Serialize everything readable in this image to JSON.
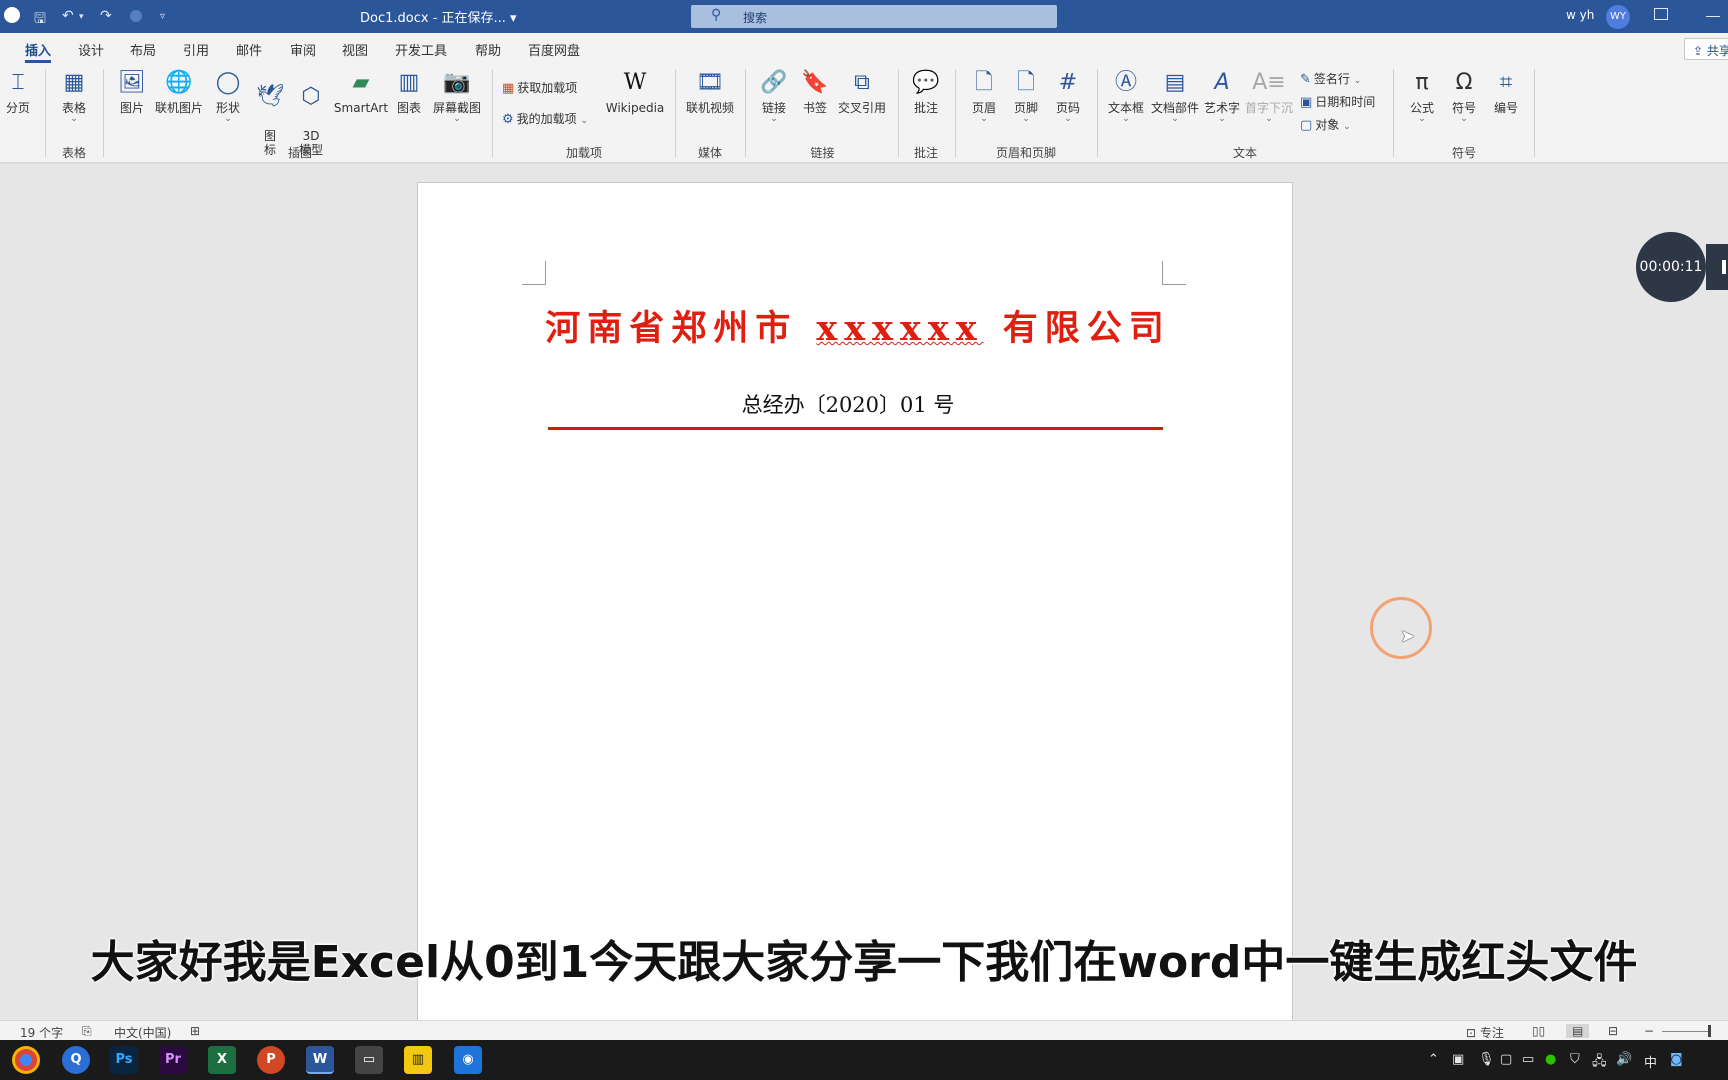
{
  "titlebar": {
    "doc_title": "Doc1.docx - 正在保存... ▾",
    "search_placeholder": "搜索",
    "user_name": "w yh",
    "user_initials": "WY"
  },
  "tabs": [
    "插入",
    "设计",
    "布局",
    "引用",
    "邮件",
    "审阅",
    "视图",
    "开发工具",
    "帮助",
    "百度网盘"
  ],
  "share_label": "共享",
  "ribbon": {
    "page_break": "分页",
    "table": "表格",
    "picture": "图片",
    "online_picture": "联机图片",
    "shapes": "形状",
    "icons": "图\n标",
    "model3d": "3D\n模型",
    "smartart": "SmartArt",
    "chart": "图表",
    "screenshot": "屏幕截图",
    "get_addins": "获取加载项",
    "my_addins": "我的加载项",
    "wikipedia": "Wikipedia",
    "online_video": "联机视频",
    "link": "链接",
    "bookmark": "书签",
    "cross_ref": "交叉引用",
    "comment": "批注",
    "header": "页眉",
    "footer": "页脚",
    "page_number": "页码",
    "textbox": "文本框",
    "quick_parts": "文档部件",
    "wordart": "艺术字",
    "dropcap": "首字下沉",
    "signature_line": "签名行",
    "date_time": "日期和时间",
    "object": "对象",
    "equation": "公式",
    "symbol": "符号",
    "number": "编号",
    "groups": {
      "tables": "表格",
      "illustrations": "插图",
      "addins": "加载项",
      "media": "媒体",
      "links": "链接",
      "comments": "批注",
      "header_footer": "页眉和页脚",
      "text": "文本",
      "symbols": "符号"
    }
  },
  "document": {
    "heading_prefix": "河南省郑州市 ",
    "heading_underlined": "xxxxxx",
    "heading_suffix": " 有限公司",
    "subheading": "总经办〔2020〕01 号"
  },
  "recorder_time": "00:00:11",
  "subtitle": "大家好我是Excel从0到1今天跟大家分享一下我们在word中一键生成红头文件",
  "statusbar": {
    "word_count": "19 个字",
    "language": "中文(中国)",
    "focus": "专注"
  },
  "taskbar": {
    "ime": "中"
  },
  "colors": {
    "title_blue": "#2b579a",
    "heading_red": "#e01f10",
    "rule_red": "#d11b0f"
  }
}
